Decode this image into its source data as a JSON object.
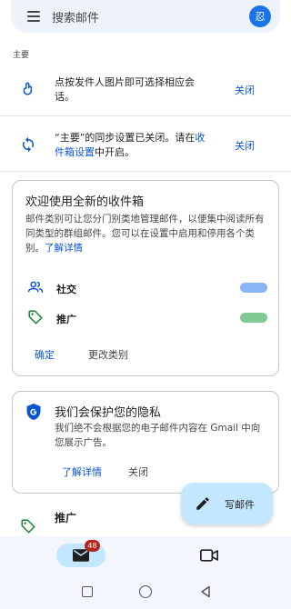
{
  "search": {
    "placeholder": "搜索邮件",
    "avatar_initial": "忍"
  },
  "section_label": "主要",
  "tips": [
    {
      "text": "点按发件人图片即可选择相应会话。",
      "close": "关闭"
    },
    {
      "text_before": "“主要”的同步设置已关闭。请在",
      "link": "收件箱设置",
      "text_after": "中开启。",
      "close": "关闭"
    }
  ],
  "categories_card": {
    "title": "欢迎使用全新的收件箱",
    "body": "邮件类别可让您分门别类地管理邮件，以便集中阅读所有同类型的群组邮件。您可以在设置中启用和停用各个类别。",
    "learn_more": "了解详情",
    "categories": [
      {
        "label": "社交",
        "color": "#8ab4f8"
      },
      {
        "label": "推广",
        "color": "#81c995"
      }
    ],
    "confirm": "确定",
    "change": "更改类别"
  },
  "privacy_card": {
    "title": "我们会保护您的隐私",
    "body": "我们绝不会根据您的电子邮件内容在 Gmail 中向您展示广告。",
    "learn_more": "了解详情",
    "close": "关闭"
  },
  "promo_row": {
    "label": "推广"
  },
  "compose": {
    "label": "写邮件"
  },
  "bottom_nav": {
    "mail_badge": "48"
  },
  "colors": {
    "accent": "#0b57d0",
    "avatar": "#1a73e8",
    "fab": "#c2e7ff",
    "badge": "#b3261e",
    "promo_green": "#188038"
  }
}
